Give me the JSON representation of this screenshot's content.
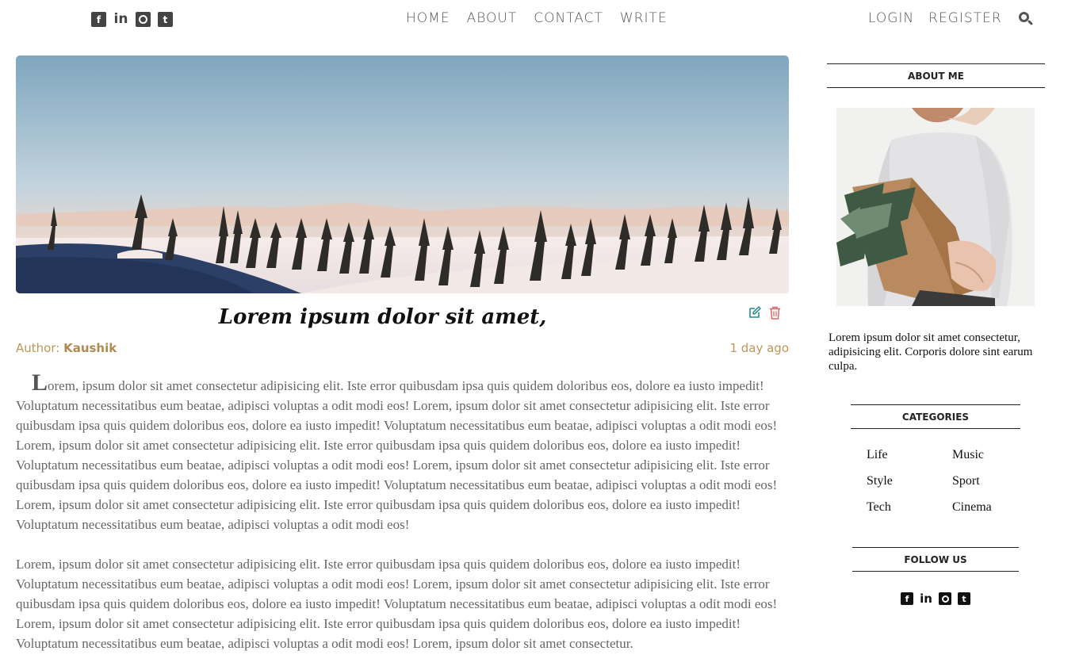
{
  "header": {
    "social_icons": [
      "facebook-square-icon",
      "linkedin-icon",
      "github-square-icon",
      "twitter-square-icon"
    ],
    "nav": [
      "HOME",
      "ABOUT",
      "CONTACT",
      "WRITE"
    ],
    "auth": [
      "LOGIN",
      "REGISTER"
    ],
    "search_icon": "search-icon"
  },
  "post": {
    "title": "Lorem ipsum dolor sit amet,",
    "author_label": "Author:",
    "author_name": "Kaushik",
    "date": "1 day ago",
    "edit_icon": "edit-icon",
    "delete_icon": "trash-icon",
    "paragraphs": [
      "Lorem, ipsum dolor sit amet consectetur adipisicing elit. Iste error quibusdam ipsa quis quidem doloribus eos, dolore ea iusto impedit! Voluptatum necessitatibus eum beatae, adipisci voluptas a odit modi eos! Lorem, ipsum dolor sit amet consectetur adipisicing elit. Iste error quibusdam ipsa quis quidem doloribus eos, dolore ea iusto impedit! Voluptatum necessitatibus eum beatae, adipisci voluptas a odit modi eos! Lorem, ipsum dolor sit amet consectetur adipisicing elit. Iste error quibusdam ipsa quis quidem doloribus eos, dolore ea iusto impedit! Voluptatum necessitatibus eum beatae, adipisci voluptas a odit modi eos! Lorem, ipsum dolor sit amet consectetur adipisicing elit. Iste error quibusdam ipsa quis quidem doloribus eos, dolore ea iusto impedit! Voluptatum necessitatibus eum beatae, adipisci voluptas a odit modi eos! Lorem, ipsum dolor sit amet consectetur adipisicing elit. Iste error quibusdam ipsa quis quidem doloribus eos, dolore ea iusto impedit! Voluptatum necessitatibus eum beatae, adipisci voluptas a odit modi eos!",
      "Lorem, ipsum dolor sit amet consectetur adipisicing elit. Iste error quibusdam ipsa quis quidem doloribus eos, dolore ea iusto impedit! Voluptatum necessitatibus eum beatae, adipisci voluptas a odit modi eos! Lorem, ipsum dolor sit amet consectetur adipisicing elit. Iste error quibusdam ipsa quis quidem doloribus eos, dolore ea iusto impedit! Voluptatum necessitatibus eum beatae, adipisci voluptas a odit modi eos! Lorem, ipsum dolor sit amet consectetur adipisicing elit. Iste error quibusdam ipsa quis quidem doloribus eos, dolore ea iusto impedit! Voluptatum necessitatibus eum beatae, adipisci voluptas a odit modi eos! Lorem, ipsum dolor sit amet consectetur."
    ]
  },
  "sidebar": {
    "about_title": "ABOUT ME",
    "about_text": "Lorem ipsum dolor sit amet consectetur, adipisicing elit. Corporis dolore sint earum culpa.",
    "categories_title": "CATEGORIES",
    "categories": [
      "Life",
      "Music",
      "Style",
      "Sport",
      "Tech",
      "Cinema"
    ],
    "follow_title": "FOLLOW US",
    "social_icons": [
      "facebook-square-icon",
      "linkedin-icon",
      "github-square-icon",
      "twitter-square-icon"
    ]
  },
  "colors": {
    "accent": "#be9656",
    "edit": "#2a8a8a",
    "delete": "#e06666",
    "text": "#666666",
    "nav": "#555555"
  }
}
